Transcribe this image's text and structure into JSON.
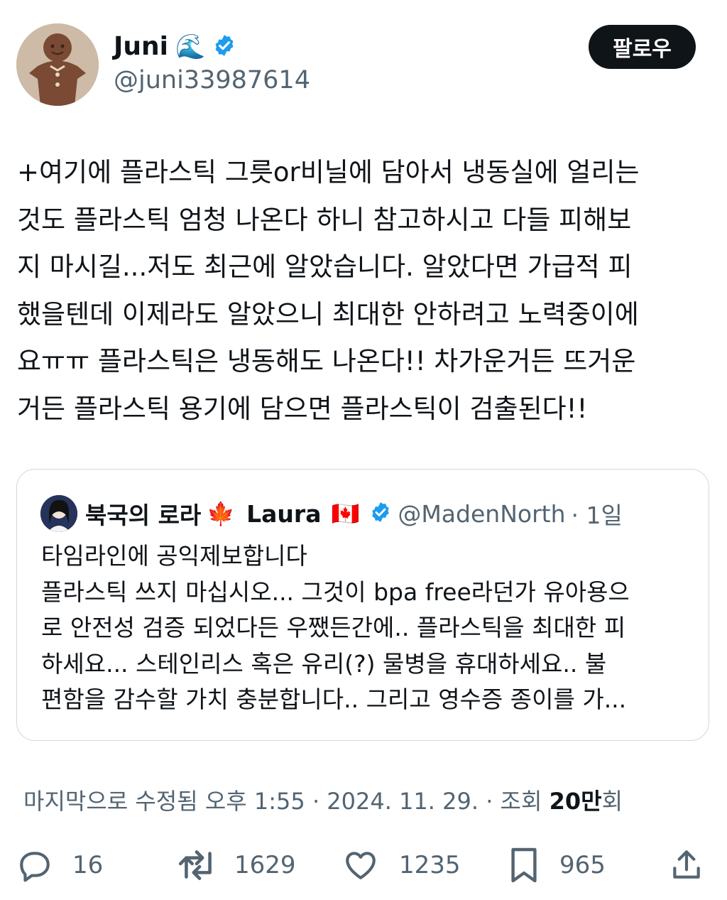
{
  "author": {
    "name": "Juni",
    "emoji": "🌊",
    "handle": "@juni33987614",
    "follow_label": "팔로우"
  },
  "tweet": {
    "text": "+여기에 플라스틱 그릇or비닐에 담아서 냉동실에 얼리는\n것도 플라스틱 엄청 나온다 하니 참고하시고 다들 피해보\n지 마시길...저도 최근에 알았습니다. 알았다면 가급적 피\n했을텐데 이제라도 알았으니 최대한 안하려고 노력중이에\n요ㅠㅠ 플라스틱은 냉동해도 나온다!! 차가운거든 뜨거운\n거든 플라스틱 용기에 담으면 플라스틱이 검출된다!!"
  },
  "quote": {
    "name": "북국의 로라",
    "name_emoji": "🍁",
    "name_latin": "Laura",
    "name_flag": "🇨🇦",
    "handle": "@MadenNorth",
    "time": "· 1일",
    "text": "타임라인에 공익제보합니다\n플라스틱 쓰지 마십시오... 그것이 bpa free라던가 유아용으\n로 안전성 검증 되었다든 우쨌든간에.. 플라스틱을 최대한 피\n하세요...  스테인리스 혹은 유리(?) 물병을 휴대하세요.. 불\n편함을 감수할 가치 충분합니다.. 그리고 영수증 종이를 가..."
  },
  "meta": {
    "edited": "마지막으로 수정됨 오후 1:55 · 2024. 11. 29.  · 조회 ",
    "views": "20만",
    "views_suffix": "회"
  },
  "actions": {
    "replies": "16",
    "retweets": "1629",
    "likes": "1235",
    "bookmarks": "965"
  },
  "colors": {
    "text": "#0f1419",
    "secondary": "#536471",
    "verified": "#1d9bf0",
    "border": "#cfd9de"
  }
}
